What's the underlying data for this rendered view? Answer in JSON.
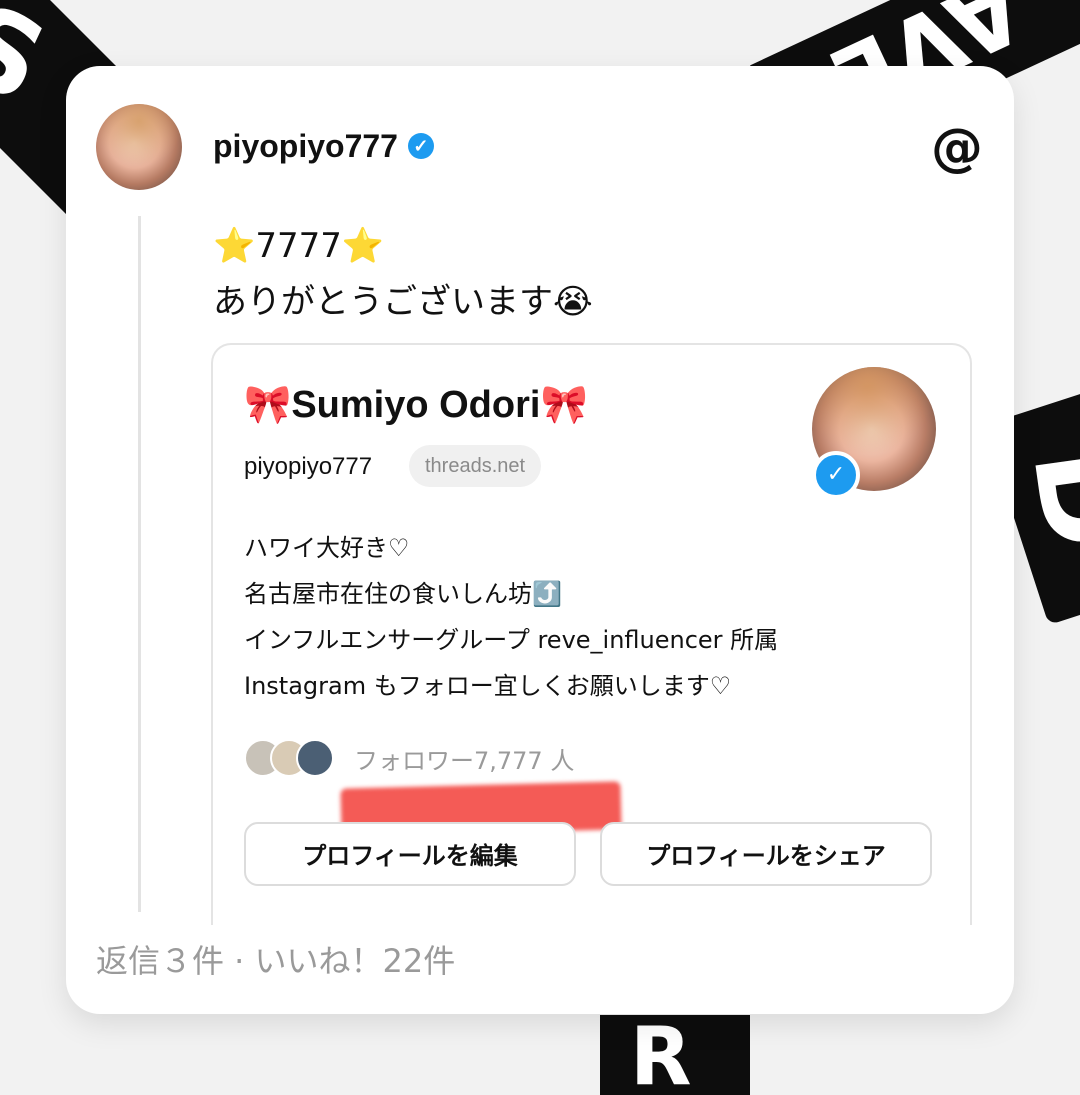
{
  "post": {
    "username": "piyopiyo777",
    "line1": "⭐7777⭐",
    "line2": "ありがとうございます😭",
    "stats": "返信３件 · いいね！22件"
  },
  "profile_card": {
    "display_name": "🎀Sumiyo Odori🎀",
    "handle": "piyopiyo777",
    "domain": "threads.net",
    "bio": [
      "ハワイ大好き♡",
      "名古屋市在住の食いしん坊⤴️",
      "インフルエンサーグループ reve_influencer 所属",
      "Instagram もフォロー宜しくお願いします♡"
    ],
    "followers": "フォロワー7,777 人",
    "edit_button": "プロフィールを編集",
    "share_button": "プロフィールをシェア"
  },
  "icons": {
    "verified": "verified-check-icon",
    "threads": "threads-logo-icon"
  },
  "colors": {
    "verified_blue": "#1d9bf0",
    "redaction": "#f45b56"
  }
}
